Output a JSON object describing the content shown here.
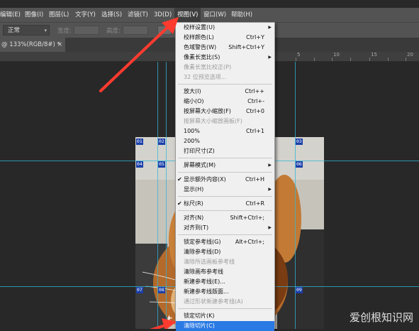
{
  "menubar": {
    "items": [
      {
        "label": "编辑(E)"
      },
      {
        "label": "图像(I)"
      },
      {
        "label": "图层(L)"
      },
      {
        "label": "文字(Y)"
      },
      {
        "label": "选择(S)"
      },
      {
        "label": "滤镜(T)"
      },
      {
        "label": "3D(D)"
      },
      {
        "label": "视图(V)",
        "active": true
      },
      {
        "label": "窗口(W)"
      },
      {
        "label": "帮助(H)"
      }
    ]
  },
  "options": {
    "mode": "正常",
    "width_label": "宽度:",
    "height_label": "高度:"
  },
  "document_tab": {
    "title": "@ 133%(RGB/8#) *",
    "close": "×"
  },
  "ruler": {
    "ticks": [
      "5",
      "10",
      "15",
      "20"
    ]
  },
  "slices": [
    "01",
    "02",
    "03",
    "04",
    "05",
    "06",
    "07",
    "08",
    "09"
  ],
  "view_menu": {
    "items": [
      {
        "label": "校样设置(U)",
        "submenu": true
      },
      {
        "label": "校样颜色(L)",
        "shortcut": "Ctrl+Y"
      },
      {
        "label": "色域警告(W)",
        "shortcut": "Shift+Ctrl+Y"
      },
      {
        "label": "像素长宽比(S)",
        "submenu": true
      },
      {
        "label": "像素长宽比校正(P)",
        "disabled": true
      },
      {
        "label": "32 位预览选项...",
        "disabled": true
      },
      {
        "separator": true
      },
      {
        "label": "放大(I)",
        "shortcut": "Ctrl++"
      },
      {
        "label": "缩小(O)",
        "shortcut": "Ctrl+-"
      },
      {
        "label": "按屏幕大小缩放(F)",
        "shortcut": "Ctrl+0"
      },
      {
        "label": "按屏幕大小缩放画板(F)",
        "disabled": true
      },
      {
        "label": "100%",
        "shortcut": "Ctrl+1"
      },
      {
        "label": "200%"
      },
      {
        "label": "打印尺寸(Z)"
      },
      {
        "separator": true
      },
      {
        "label": "屏幕模式(M)",
        "submenu": true
      },
      {
        "separator": true
      },
      {
        "label": "显示额外内容(X)",
        "shortcut": "Ctrl+H",
        "checked": true
      },
      {
        "label": "显示(H)",
        "submenu": true
      },
      {
        "separator": true
      },
      {
        "label": "标尺(R)",
        "shortcut": "Ctrl+R",
        "checked": true
      },
      {
        "separator": true
      },
      {
        "label": "对齐(N)",
        "shortcut": "Shift+Ctrl+;"
      },
      {
        "label": "对齐到(T)",
        "submenu": true
      },
      {
        "separator": true
      },
      {
        "label": "锁定参考线(G)",
        "shortcut": "Alt+Ctrl+;"
      },
      {
        "label": "清除参考线(D)"
      },
      {
        "label": "清除所选画板参考线",
        "disabled": true
      },
      {
        "label": "清除画布参考线"
      },
      {
        "label": "新建参考线(E)..."
      },
      {
        "label": "新建参考线版面..."
      },
      {
        "label": "通过形状新建参考线(A)",
        "disabled": true
      },
      {
        "separator": true
      },
      {
        "label": "锁定切片(K)"
      },
      {
        "label": "清除切片(C)",
        "highlighted": true
      }
    ]
  },
  "watermark": "爱创根知识网",
  "colors": {
    "accent": "#2a7ae4",
    "guide": "#2fb7d9",
    "arrow": "#ff3b2f",
    "slice": "#1b3fa8"
  }
}
